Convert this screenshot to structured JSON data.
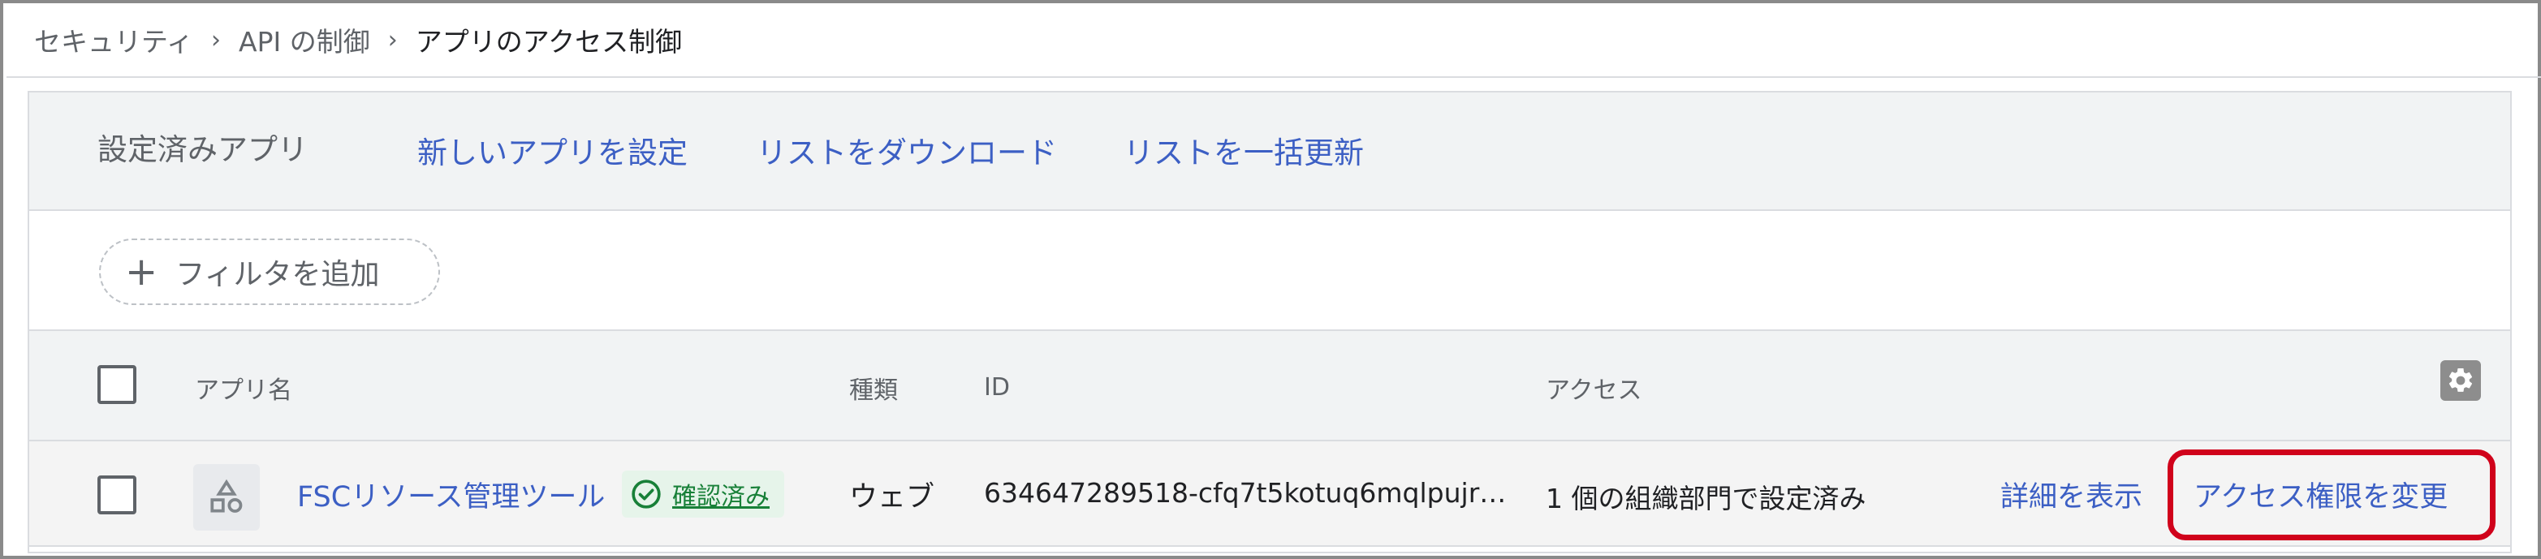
{
  "breadcrumb": {
    "items": [
      "セキュリティ",
      "API の制御",
      "アプリのアクセス制御"
    ],
    "separator": "›"
  },
  "toolbar": {
    "title": "設定済みアプリ",
    "links": [
      "新しいアプリを設定",
      "リストをダウンロード",
      "リストを一括更新"
    ]
  },
  "filter": {
    "label": "フィルタを追加",
    "icon": "plus-icon"
  },
  "table": {
    "columns": [
      "アプリ名",
      "種類",
      "ID",
      "アクセス"
    ],
    "settings_icon": "gear-icon",
    "rows": [
      {
        "app_name": "FSCリソース管理ツール",
        "status": "確認済み",
        "type": "ウェブ",
        "id": "634647289518-cfq7t5kotuq6mqlpujr…",
        "access": "1 個の組織部門で設定済み",
        "action_details": "詳細を表示",
        "action_change": "アクセス権限を変更"
      }
    ]
  },
  "colors": {
    "link": "#3c5fc4",
    "verified": "#188038",
    "highlight": "#d0021b"
  }
}
